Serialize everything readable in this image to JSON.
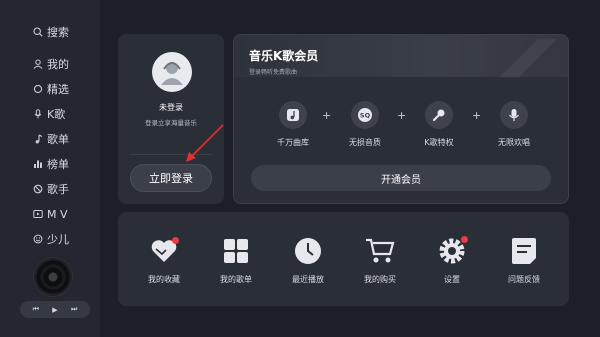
{
  "sidebar": {
    "items": [
      {
        "label": "搜索",
        "icon": "search-icon"
      },
      {
        "label": "我的",
        "icon": "user-icon"
      },
      {
        "label": "精选",
        "icon": "circle-icon"
      },
      {
        "label": "K歌",
        "icon": "microphone-icon"
      },
      {
        "label": "歌单",
        "icon": "music-note-icon"
      },
      {
        "label": "榜单",
        "icon": "chart-bar-icon"
      },
      {
        "label": "歌手",
        "icon": "no-entry-icon"
      },
      {
        "label": "M V",
        "icon": "play-box-icon"
      },
      {
        "label": "少儿",
        "icon": "smile-icon"
      }
    ]
  },
  "player": {
    "prev": "⏮",
    "play": "▶",
    "next": "⏭"
  },
  "login": {
    "name": "未登录",
    "subtitle": "登录立享海量音乐",
    "button": "立即登录"
  },
  "vip": {
    "title": "音乐K歌会员",
    "subtitle": "登录畅听免费歌曲",
    "perks": [
      {
        "label": "千万曲库",
        "icon": "music-library-icon"
      },
      {
        "label": "无损音质",
        "icon": "sq-quality-icon"
      },
      {
        "label": "K歌特权",
        "icon": "microphone-icon"
      },
      {
        "label": "无限欢唱",
        "icon": "mic-unlimited-icon"
      }
    ],
    "plus": "+",
    "open_button": "开通会员"
  },
  "features": [
    {
      "label": "我的收藏",
      "icon": "heart-icon"
    },
    {
      "label": "我的歌单",
      "icon": "grid-icon"
    },
    {
      "label": "最近播放",
      "icon": "clock-icon"
    },
    {
      "label": "我的购买",
      "icon": "cart-icon"
    },
    {
      "label": "设置",
      "icon": "gear-icon"
    },
    {
      "label": "问题反馈",
      "icon": "feedback-icon"
    }
  ],
  "colors": {
    "background": "#1c1f26",
    "sidebar": "#24272f",
    "card": "#2a2e37",
    "accent_red": "#ef3b3b"
  }
}
